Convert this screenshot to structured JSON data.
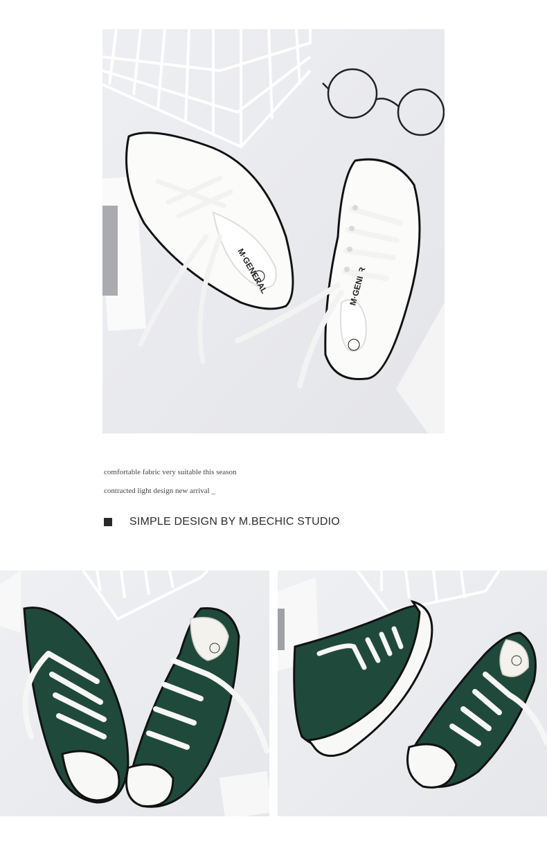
{
  "captions": [
    "comfortable fabric very suitable this season",
    "contracted light design new arrival _"
  ],
  "heading": {
    "icon": "square-icon",
    "text": "SIMPLE DESIGN BY M.BECHIC STUDIO"
  },
  "photos": {
    "hero": {
      "subject": "white-sneakers",
      "brand": "M·GENERAL",
      "size": "230"
    },
    "left": {
      "subject": "green-sneakers",
      "size": "230"
    },
    "right": {
      "subject": "green-sneakers",
      "size": "230"
    }
  },
  "colors": {
    "background": "#ffffff",
    "green_canvas": "#1f4a3b",
    "white_canvas": "#f7f7f5"
  }
}
